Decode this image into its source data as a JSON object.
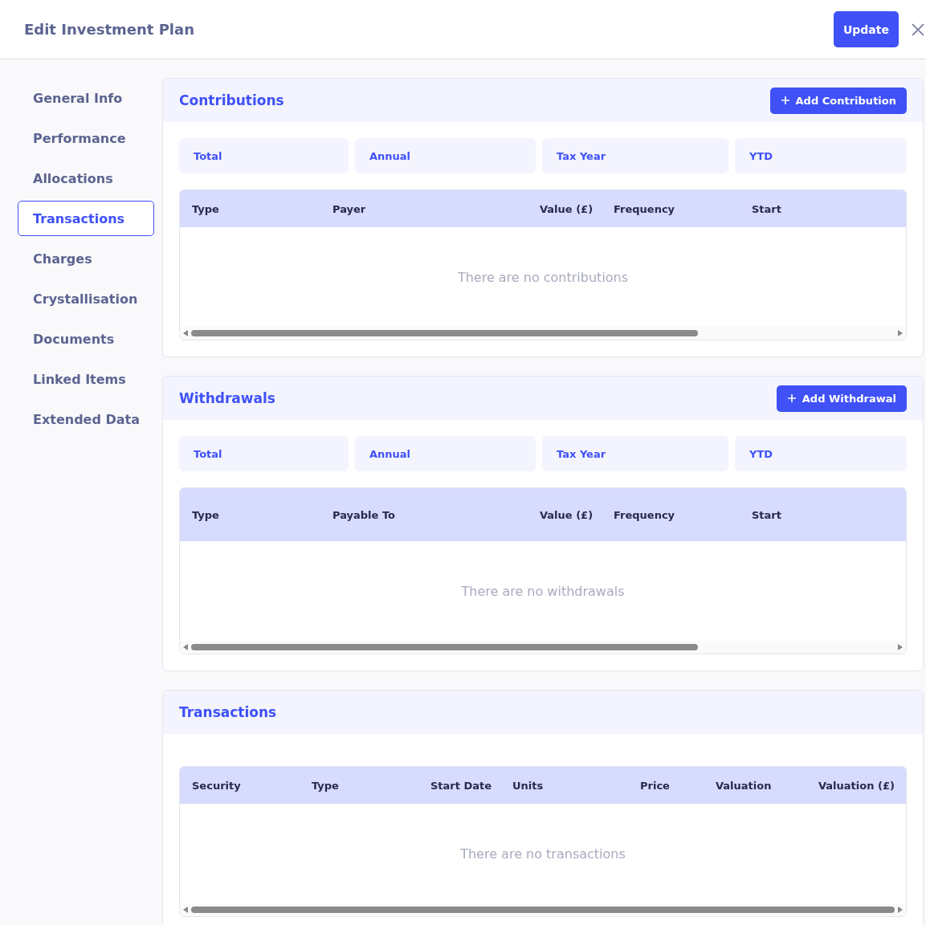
{
  "header": {
    "title": "Edit Investment Plan",
    "update_button": "Update"
  },
  "sidebar": {
    "items": [
      {
        "label": "General Info",
        "selected": false
      },
      {
        "label": "Performance",
        "selected": false
      },
      {
        "label": "Allocations",
        "selected": false
      },
      {
        "label": "Transactions",
        "selected": true
      },
      {
        "label": "Charges",
        "selected": false
      },
      {
        "label": "Crystallisation",
        "selected": false
      },
      {
        "label": "Documents",
        "selected": false
      },
      {
        "label": "Linked Items",
        "selected": false
      },
      {
        "label": "Extended Data",
        "selected": false
      }
    ]
  },
  "sections": [
    {
      "title": "Contributions",
      "add_button": "Add Contribution",
      "summary": [
        "Total",
        "Annual",
        "Tax Year",
        "YTD"
      ],
      "table": {
        "columns": [
          "Type",
          "Payer",
          "Value (£)",
          "Frequency",
          "Start"
        ],
        "empty_text": "There are no contributions"
      }
    },
    {
      "title": "Withdrawals",
      "add_button": "Add Withdrawal",
      "summary": [
        "Total",
        "Annual",
        "Tax Year",
        "YTD"
      ],
      "table": {
        "columns": [
          "Type",
          "Payable To",
          "Value (£)",
          "Frequency",
          "Start"
        ],
        "empty_text": "There are no withdrawals"
      }
    },
    {
      "title": "Transactions",
      "table": {
        "columns": [
          "Security",
          "Type",
          "Start Date",
          "Units",
          "Price",
          "Valuation",
          "Valuation (£)"
        ],
        "empty_text": "There are no transactions"
      }
    }
  ]
}
